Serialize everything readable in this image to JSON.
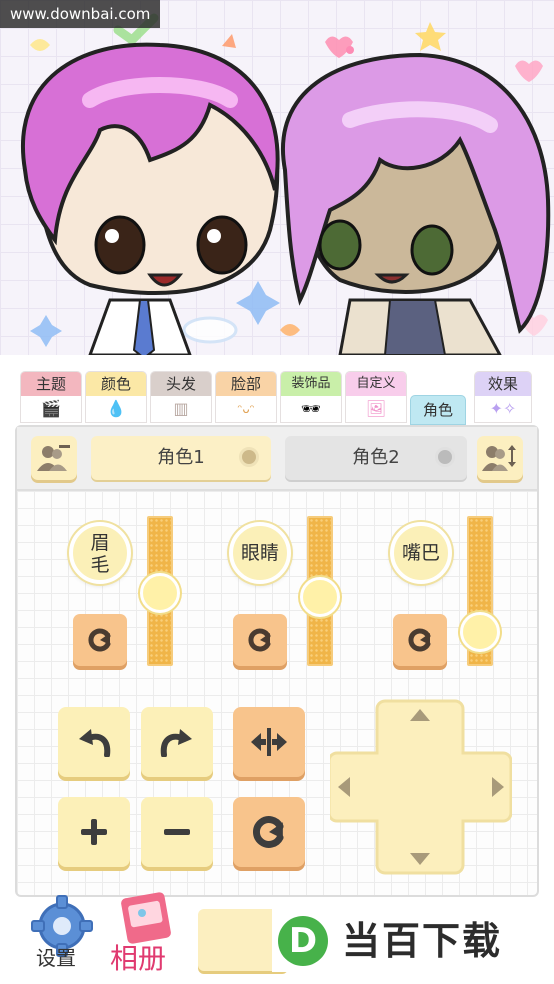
{
  "watermark": "www.downbai.com",
  "tabs": [
    {
      "label": "主题",
      "color": "#f3b7bf",
      "icon": "clapperboard-icon",
      "glyph": "🎬"
    },
    {
      "label": "颜色",
      "color": "#fbe8a6",
      "icon": "paint-drop-icon",
      "glyph": "💧"
    },
    {
      "label": "头发",
      "color": "#d9cfcb",
      "icon": "comb-icon",
      "glyph": "▥"
    },
    {
      "label": "脸部",
      "color": "#f9d3a6",
      "icon": "face-icon",
      "glyph": "ᵔᴗᵔ"
    },
    {
      "label": "装饰品",
      "color": "#c9efa9",
      "icon": "sunglasses-icon",
      "glyph": "🕶"
    },
    {
      "label": "自定义",
      "color": "#f8cdeb",
      "icon": "picture-icon",
      "glyph": "🖼"
    },
    {
      "label": "角色",
      "color": "#bfe8f2",
      "icon": "",
      "glyph": ""
    },
    {
      "label": "效果",
      "color": "#ddd2f6",
      "icon": "sparkle-icon",
      "glyph": "✦✧"
    }
  ],
  "characters": {
    "one": "角色1",
    "two": "角色2",
    "selected": "角色1"
  },
  "features": [
    {
      "label": "眉毛",
      "lines": [
        "眉",
        "毛"
      ],
      "level": 0.55
    },
    {
      "label": "眼睛",
      "lines": [
        "眼睛"
      ],
      "level": 0.55
    },
    {
      "label": "嘴巴",
      "lines": [
        "嘴巴"
      ],
      "level": 0.8
    }
  ],
  "footer": {
    "settings": "设置",
    "album": "相册",
    "ad_text": "当百下载",
    "ad_letter": "D"
  },
  "colors": {
    "accent_yellow": "#fcefc0",
    "accent_orange": "#f8c48c",
    "slider": "#f0b548",
    "ad_green": "#47b24a"
  }
}
